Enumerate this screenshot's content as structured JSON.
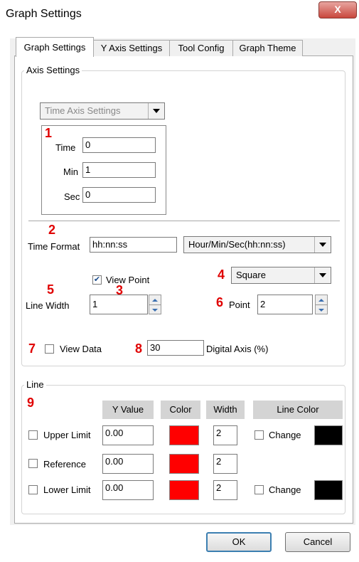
{
  "window": {
    "title": "Graph Settings",
    "close_glyph": "X"
  },
  "tabs": [
    {
      "label": "Graph Settings",
      "active": true
    },
    {
      "label": "Y Axis Settings"
    },
    {
      "label": "Tool Config"
    },
    {
      "label": "Graph Theme"
    }
  ],
  "axis_settings": {
    "group_label": "Axis Settings",
    "time_axis_select": "Time Axis Settings",
    "time_label": "Time",
    "time_value": "0",
    "min_label": "Min",
    "min_value": "1",
    "sec_label": "Sec",
    "sec_value": "0",
    "time_format_label": "Time Format",
    "time_format_value": "hh:nn:ss",
    "time_format_select": "Hour/Min/Sec(hh:nn:ss)",
    "view_point_label": "View Point",
    "view_point_checked": true,
    "point_shape_select": "Square",
    "line_width_label": "Line Width",
    "line_width_value": "1",
    "point_label": "Point",
    "point_value": "2",
    "view_data_label": "View Data",
    "view_data_checked": false,
    "digital_axis_value": "30",
    "digital_axis_label": "Digital Axis (%)"
  },
  "callouts": [
    "1",
    "2",
    "3",
    "4",
    "5",
    "6",
    "7",
    "8",
    "9"
  ],
  "line": {
    "group_label": "Line",
    "headers": {
      "y_value": "Y Value",
      "color": "Color",
      "width": "Width",
      "line_color": "Line Color"
    },
    "rows": [
      {
        "label": "Upper Limit",
        "y_value": "0.00",
        "color": "#ff0000",
        "width": "2",
        "change_label": "Change",
        "line_color": "#000000"
      },
      {
        "label": "Reference",
        "y_value": "0.00",
        "color": "#ff0000",
        "width": "2"
      },
      {
        "label": "Lower Limit",
        "y_value": "0.00",
        "color": "#ff0000",
        "width": "2",
        "change_label": "Change",
        "line_color": "#000000"
      }
    ]
  },
  "buttons": {
    "ok": "OK",
    "cancel": "Cancel"
  },
  "icons": {
    "dropdown": "chevron-down-icon",
    "spin_up": "spin-up-icon",
    "spin_down": "spin-down-icon",
    "check": "check-icon"
  }
}
